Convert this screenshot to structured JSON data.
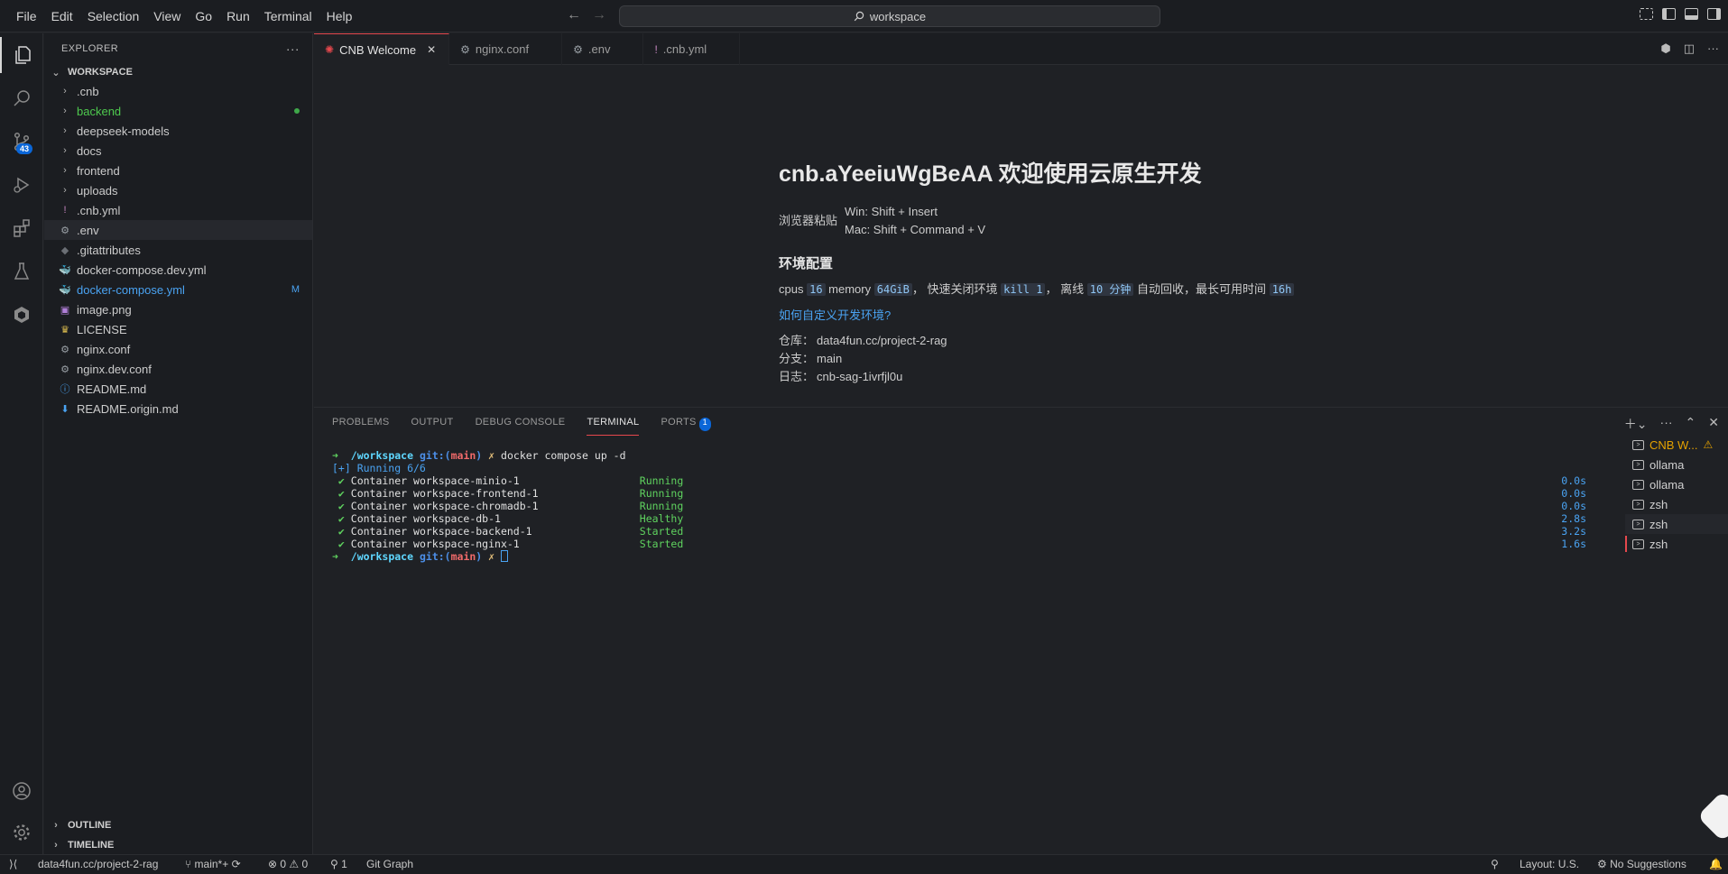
{
  "menu": [
    "File",
    "Edit",
    "Selection",
    "View",
    "Go",
    "Run",
    "Terminal",
    "Help"
  ],
  "search": {
    "text": "workspace"
  },
  "activity": {
    "scm_badge": "43"
  },
  "explorer": {
    "title": "EXPLORER",
    "workspace": "WORKSPACE",
    "items": [
      {
        "name": ".cnb",
        "type": "folder",
        "color": "#cccccc"
      },
      {
        "name": "backend",
        "type": "folder",
        "color": "#4ec94e",
        "dot": true
      },
      {
        "name": "deepseek-models",
        "type": "folder",
        "color": "#cccccc"
      },
      {
        "name": "docs",
        "type": "folder",
        "color": "#cccccc"
      },
      {
        "name": "frontend",
        "type": "folder",
        "color": "#cccccc"
      },
      {
        "name": "uploads",
        "type": "folder",
        "color": "#cccccc"
      },
      {
        "name": ".cnb.yml",
        "type": "file",
        "icon": "!",
        "iconColor": "#c586c0",
        "color": "#cccccc"
      },
      {
        "name": ".env",
        "type": "file",
        "icon": "⚙",
        "iconColor": "#9aa0a6",
        "color": "#cccccc",
        "selected": true
      },
      {
        "name": ".gitattributes",
        "type": "file",
        "icon": "◆",
        "iconColor": "#6b6f75",
        "color": "#cccccc"
      },
      {
        "name": "docker-compose.dev.yml",
        "type": "file",
        "icon": "🐳",
        "iconColor": "#e5484d",
        "color": "#cccccc"
      },
      {
        "name": "docker-compose.yml",
        "type": "file",
        "icon": "🐳",
        "iconColor": "#e5484d",
        "color": "#4aa3f2",
        "status": "M"
      },
      {
        "name": "image.png",
        "type": "file",
        "icon": "▣",
        "iconColor": "#b07fd8",
        "color": "#cccccc"
      },
      {
        "name": "LICENSE",
        "type": "file",
        "icon": "♛",
        "iconColor": "#e0c050",
        "color": "#cccccc"
      },
      {
        "name": "nginx.conf",
        "type": "file",
        "icon": "⚙",
        "iconColor": "#9aa0a6",
        "color": "#cccccc"
      },
      {
        "name": "nginx.dev.conf",
        "type": "file",
        "icon": "⚙",
        "iconColor": "#9aa0a6",
        "color": "#cccccc"
      },
      {
        "name": "README.md",
        "type": "file",
        "icon": "ⓘ",
        "iconColor": "#4aa3f2",
        "color": "#cccccc"
      },
      {
        "name": "README.origin.md",
        "type": "file",
        "icon": "⬇",
        "iconColor": "#4aa3f2",
        "color": "#cccccc"
      }
    ],
    "outline": "OUTLINE",
    "timeline": "TIMELINE"
  },
  "tabs": [
    {
      "label": "CNB Welcome",
      "icon": "✺",
      "iconColor": "#e5484d",
      "active": true
    },
    {
      "label": "nginx.conf",
      "icon": "⚙",
      "iconColor": "#9aa0a6"
    },
    {
      "label": ".env",
      "icon": "⚙",
      "iconColor": "#9aa0a6"
    },
    {
      "label": ".cnb.yml",
      "icon": "!",
      "iconColor": "#c586c0"
    }
  ],
  "welcome": {
    "title": "cnb.aYeeiuWgBeAA 欢迎使用云原生开发",
    "paste_label": "浏览器粘贴",
    "paste_win": "Win: Shift + Insert",
    "paste_mac": "Mac: Shift + Command + V",
    "env_heading": "环境配置",
    "cpus_label": "cpus",
    "cpus": "16",
    "memory_label": "memory",
    "memory": "64GiB",
    "kill_label": "， 快速关闭环境",
    "kill": "kill 1",
    "offline_label": "， 离线",
    "offline": "10 分钟",
    "recycle_label": "自动回收，最长可用时间",
    "max_time": "16h",
    "custom_link": "如何自定义开发环境?",
    "repo_label": "仓库：",
    "repo": "data4fun.cc/project-2-rag",
    "branch_label": "分支：",
    "branch": "main",
    "log_label": "日志：",
    "log": "cnb-sag-1ivrfjl0u"
  },
  "panel": {
    "tabs": [
      "PROBLEMS",
      "OUTPUT",
      "DEBUG CONSOLE",
      "TERMINAL",
      "PORTS"
    ],
    "ports_badge": "1"
  },
  "terminal": {
    "prompt_dir": "/workspace",
    "git_label": "git:(",
    "branch": "main",
    "git_close": ")",
    "x_mark": "✗",
    "command": "docker compose up -d",
    "running": "[+] Running 6/6",
    "containers": [
      {
        "name": "Container workspace-minio-1",
        "state": "Running",
        "time": "0.0s"
      },
      {
        "name": "Container workspace-frontend-1",
        "state": "Running",
        "time": "0.0s"
      },
      {
        "name": "Container workspace-chromadb-1",
        "state": "Running",
        "time": "0.0s"
      },
      {
        "name": "Container workspace-db-1",
        "state": "Healthy",
        "time": "2.8s"
      },
      {
        "name": "Container workspace-backend-1",
        "state": "Started",
        "time": "3.2s"
      },
      {
        "name": "Container workspace-nginx-1",
        "state": "Started",
        "time": "1.6s"
      }
    ]
  },
  "terminal_list": [
    {
      "label": "CNB W...",
      "warn": true,
      "color": "#e5a200"
    },
    {
      "label": "ollama"
    },
    {
      "label": "ollama"
    },
    {
      "label": "zsh"
    },
    {
      "label": "zsh",
      "selected": true
    },
    {
      "label": "zsh",
      "marked": true
    }
  ],
  "status": {
    "repo": "data4fun.cc/project-2-rag",
    "branch": "main*+",
    "errors": "0",
    "warnings": "0",
    "ports": "1",
    "git_graph": "Git Graph",
    "layout": "Layout: U.S.",
    "suggestions": "No Suggestions"
  }
}
